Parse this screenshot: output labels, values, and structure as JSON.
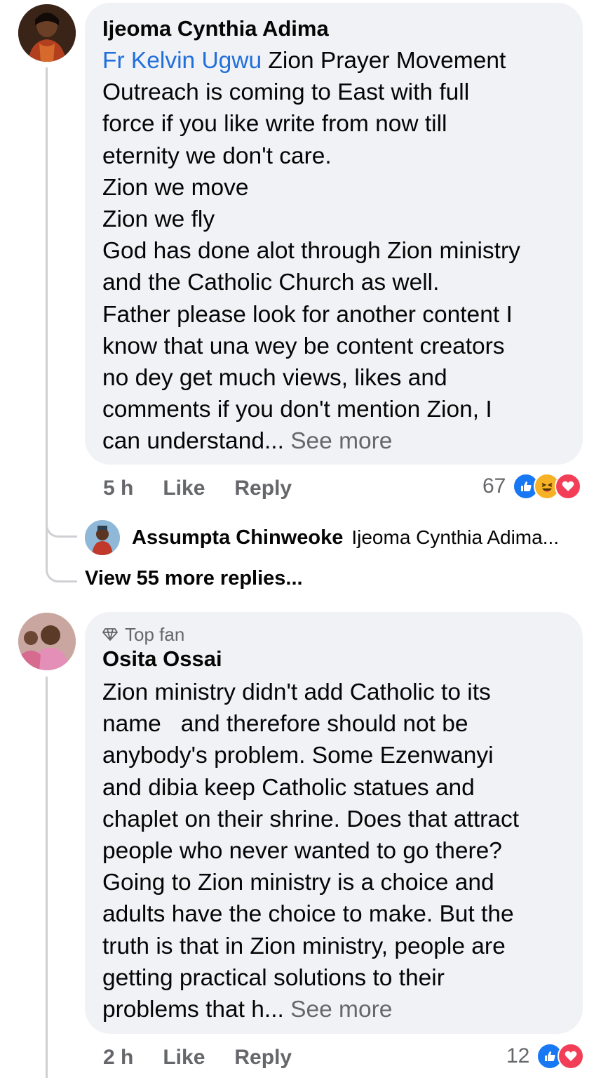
{
  "comments": [
    {
      "author": "Ijeoma Cynthia Adima",
      "mention": "Fr Kelvin Ugwu",
      "first_line_rest": " Zion Prayer Movement",
      "lines": [
        "Outreach is coming to East with full",
        "force if you like write from now till",
        "eternity we don't care.",
        "Zion we move",
        "Zion we fly",
        "God has done alot through Zion ministry",
        "and the Catholic Church as well.",
        "Father please look for another content I",
        "know that una wey be content creators",
        "no dey get much views, likes and",
        "comments if you don't mention Zion, I"
      ],
      "last_line": "can understand...",
      "see_more": "See more",
      "time": "5 h",
      "like": "Like",
      "reply": "Reply",
      "reaction_count": "67",
      "reactions": [
        "like-icon",
        "haha-icon",
        "love-icon"
      ]
    },
    {
      "badge": "Top fan",
      "badge_icon": "diamond-icon",
      "author": "Osita Ossai",
      "lines": [
        "Zion ministry didn't add Catholic to its",
        "name   and therefore should not be",
        "anybody's problem. Some Ezenwanyi",
        "and dibia keep Catholic statues and",
        "chaplet on their shrine. Does that attract",
        "people who never wanted to go there?",
        "Going to Zion ministry is a choice and",
        "adults have the choice to make. But the",
        "truth is that in Zion ministry, people are",
        "getting practical solutions to their"
      ],
      "last_line": "problems that h...",
      "see_more": "See more",
      "time": "2 h",
      "like": "Like",
      "reply": "Reply",
      "reaction_count": "12",
      "reactions": [
        "like-icon",
        "love-icon"
      ]
    }
  ],
  "reply_preview": {
    "author": "Assumpta Chinweoke",
    "snippet": "Ijeoma Cynthia Adima..."
  },
  "view_more_replies": "View 55 more replies...",
  "colors": {
    "bubble": "#f0f2f5",
    "mention": "#216fdb",
    "secondary_text": "#65676b",
    "like_blue": "#1877f2",
    "love_red": "#f33e58",
    "haha_yellow": "#f7b125"
  }
}
